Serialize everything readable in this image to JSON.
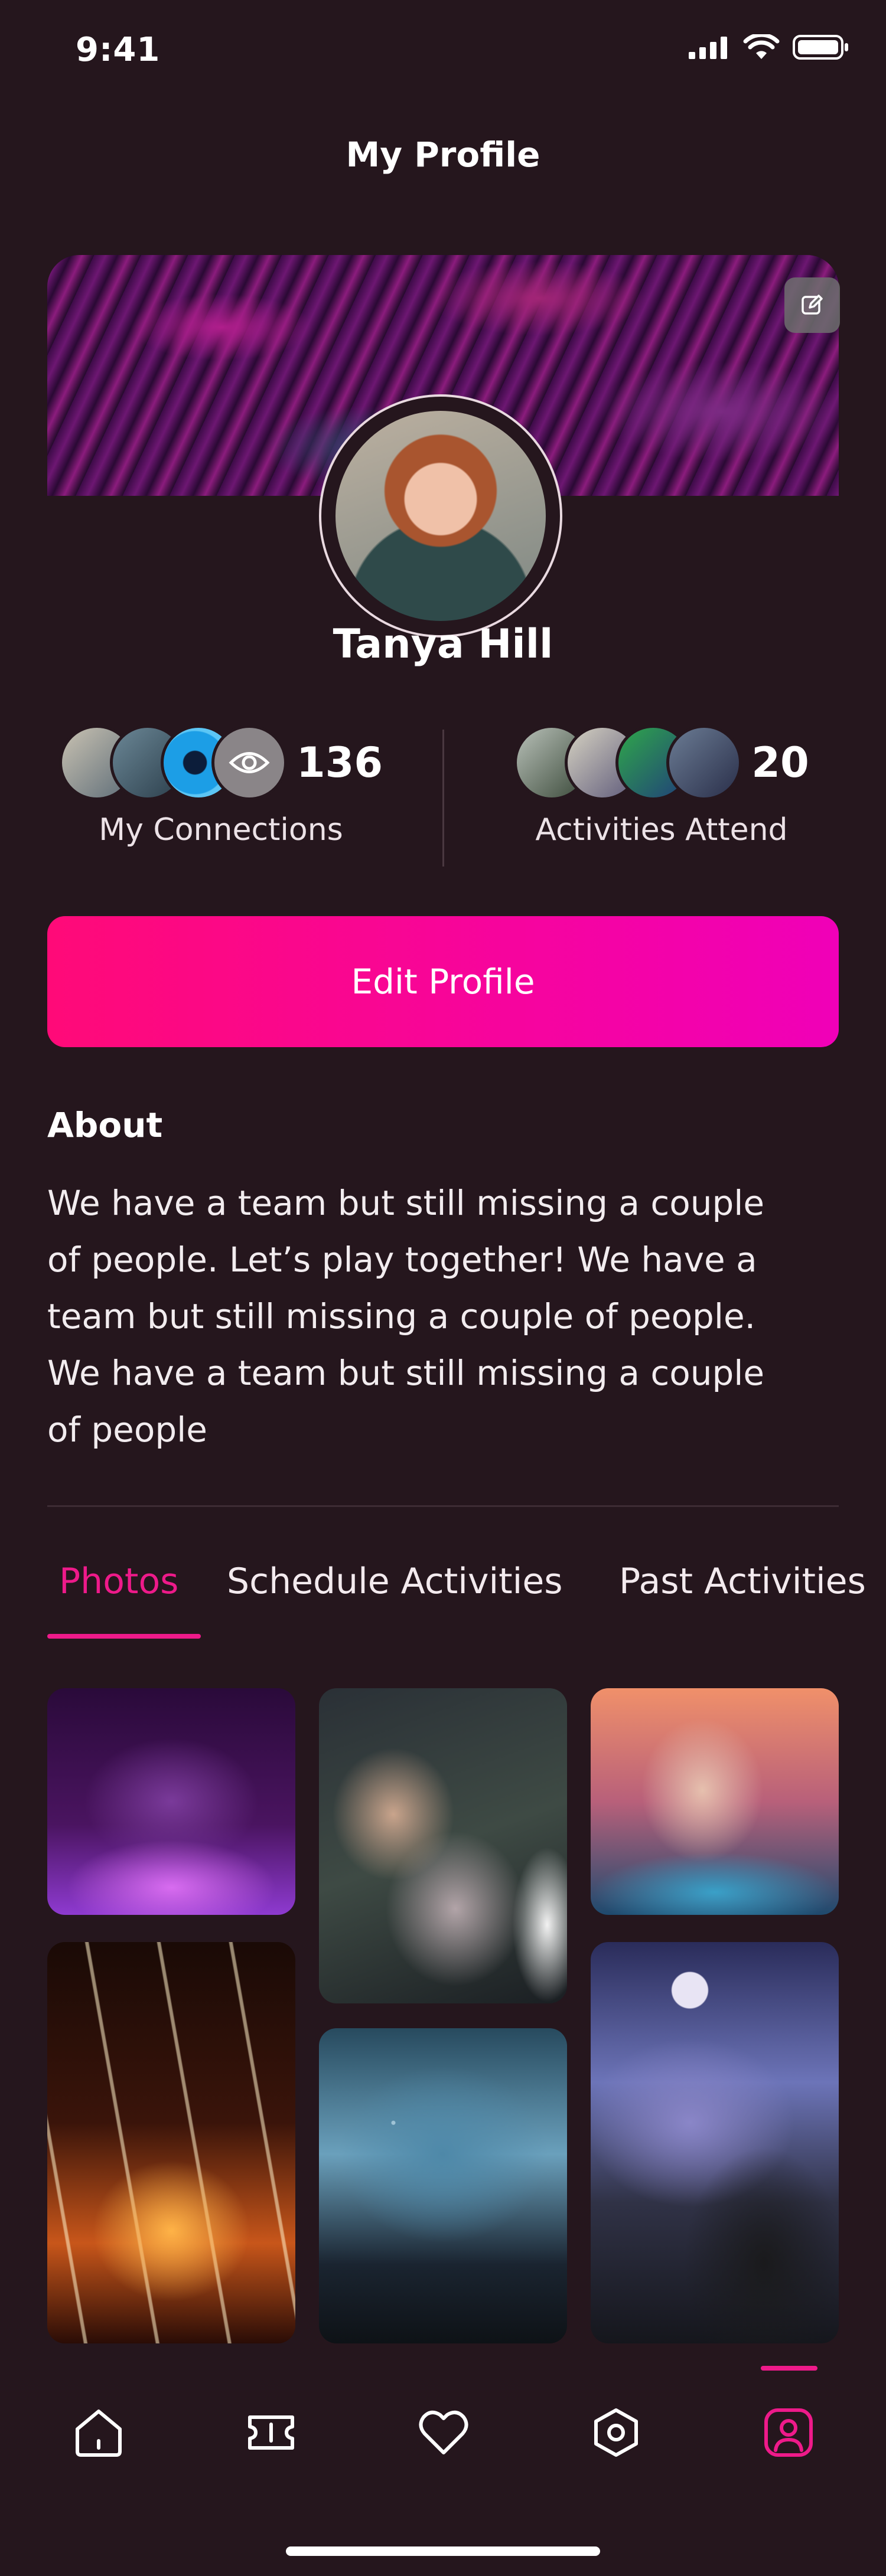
{
  "status_bar": {
    "time": "9:41",
    "icons": [
      "signal-icon",
      "wifi-icon",
      "battery-icon"
    ]
  },
  "header": {
    "title": "My Profile"
  },
  "profile": {
    "name": "Tanya Hill"
  },
  "stats": {
    "connections": {
      "count": "136",
      "label": "My Connections"
    },
    "activities": {
      "count": "20",
      "label": "Activities Attend"
    }
  },
  "actions": {
    "edit_profile_label": "Edit Profile"
  },
  "about": {
    "title": "About",
    "lines": [
      "We have a team but still missing a couple",
      "of people. Let’s play together! We have a",
      "team but still missing a couple of people.",
      "We have a team but still missing a couple",
      "of people"
    ]
  },
  "tabs": [
    {
      "label": "Photos",
      "active": true
    },
    {
      "label": "Schedule Activities",
      "active": false
    },
    {
      "label": "Past Activities",
      "active": false
    }
  ],
  "bottom_nav": {
    "items": [
      "home-icon",
      "ticket-icon",
      "heart-icon",
      "settings-icon",
      "profile-icon"
    ],
    "active": "profile-icon"
  },
  "colors": {
    "background": "#25161d",
    "accent": "#ee1a8a",
    "button_gradient_start": "#ff0a78",
    "button_gradient_end": "#f000b8"
  }
}
